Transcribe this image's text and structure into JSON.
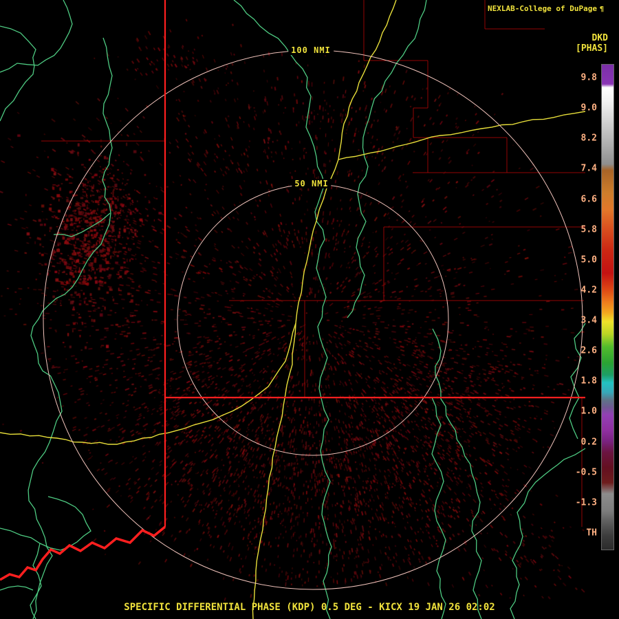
{
  "colors": {
    "background": "#000000",
    "text_yellow": "#f0e23c",
    "tick_label": "#ffb183",
    "ring": "#f2c4bc",
    "state_border": "#ff1f1f",
    "county_border": "#9c0404",
    "river": "#4ecb82",
    "highway": "#e8df3a",
    "echo": "#6e0a10"
  },
  "header": {
    "station_credit": "NEXLAB-College of DuPage",
    "logo_glyph": "¶",
    "product_code": "DKD",
    "units_label": "[PHAS]"
  },
  "range_rings": [
    {
      "label": "100 NMI"
    },
    {
      "label": "50 NMI"
    }
  ],
  "colorbar": {
    "ticks": [
      "9.8",
      "9.0",
      "8.2",
      "7.4",
      "6.6",
      "5.8",
      "5.0",
      "4.2",
      "3.4",
      "2.6",
      "1.8",
      "1.0",
      "0.2",
      "-0.5",
      "-1.3",
      "TH"
    ],
    "gradient": [
      {
        "p": 0.0,
        "c": "#7b2fa8"
      },
      {
        "p": 0.04,
        "c": "#8a35b5"
      },
      {
        "p": 0.047,
        "c": "#ffffff"
      },
      {
        "p": 0.075,
        "c": "#f2f2f2"
      },
      {
        "p": 0.11,
        "c": "#d8d8d8"
      },
      {
        "p": 0.16,
        "c": "#b2b2b2"
      },
      {
        "p": 0.205,
        "c": "#8f8f8f"
      },
      {
        "p": 0.218,
        "c": "#a96427"
      },
      {
        "p": 0.265,
        "c": "#cd7d2b"
      },
      {
        "p": 0.3,
        "c": "#e2772a"
      },
      {
        "p": 0.34,
        "c": "#d94e1f"
      },
      {
        "p": 0.385,
        "c": "#cc2613"
      },
      {
        "p": 0.43,
        "c": "#c41212"
      },
      {
        "p": 0.462,
        "c": "#dd4414"
      },
      {
        "p": 0.49,
        "c": "#ef7d1d"
      },
      {
        "p": 0.512,
        "c": "#f3a81f"
      },
      {
        "p": 0.53,
        "c": "#efe32a"
      },
      {
        "p": 0.556,
        "c": "#b8d625"
      },
      {
        "p": 0.582,
        "c": "#52bc2c"
      },
      {
        "p": 0.615,
        "c": "#2ba333"
      },
      {
        "p": 0.64,
        "c": "#1d9f66"
      },
      {
        "p": 0.656,
        "c": "#23c2c2"
      },
      {
        "p": 0.676,
        "c": "#37a8b8"
      },
      {
        "p": 0.692,
        "c": "#5f7388"
      },
      {
        "p": 0.706,
        "c": "#6f5a92"
      },
      {
        "p": 0.722,
        "c": "#9340b5"
      },
      {
        "p": 0.755,
        "c": "#8f2fa0"
      },
      {
        "p": 0.776,
        "c": "#7a2382"
      },
      {
        "p": 0.8,
        "c": "#6b1440"
      },
      {
        "p": 0.832,
        "c": "#641020"
      },
      {
        "p": 0.862,
        "c": "#6e1d1d"
      },
      {
        "p": 0.885,
        "c": "#8c8c8c"
      },
      {
        "p": 0.92,
        "c": "#7d7d7d"
      },
      {
        "p": 0.946,
        "c": "#5a5a5a"
      },
      {
        "p": 0.972,
        "c": "#3c3c3c"
      },
      {
        "p": 1.0,
        "c": "#2b2b2b"
      }
    ]
  },
  "footer": {
    "caption": "SPECIFIC DIFFERENTIAL PHASE (KDP) 0.5 DEG - KICX 19 JAN 26 02:02"
  }
}
